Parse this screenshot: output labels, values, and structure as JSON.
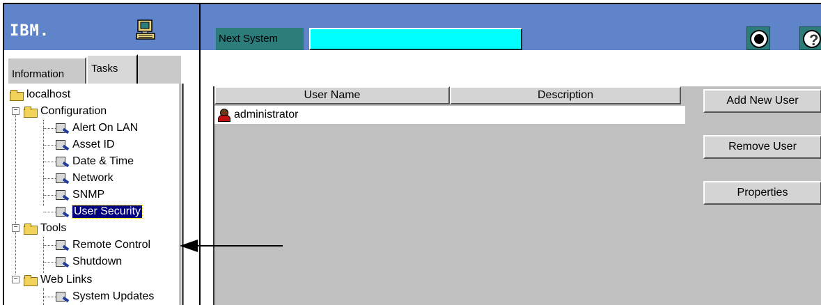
{
  "header": {
    "logo_text": "IBM.",
    "next_system_label": "Next System",
    "next_system_value": ""
  },
  "tabs": [
    {
      "label": "Information"
    },
    {
      "label": "Tasks"
    }
  ],
  "tree": {
    "root": "localhost",
    "groups": [
      {
        "label": "Configuration",
        "items": [
          "Alert On LAN",
          "Asset ID",
          "Date & Time",
          "Network",
          "SNMP",
          "User Security"
        ]
      },
      {
        "label": "Tools",
        "items": [
          "Remote Control",
          "Shutdown"
        ]
      },
      {
        "label": "Web Links",
        "items": [
          "System Updates"
        ]
      }
    ],
    "selected": "User Security"
  },
  "table": {
    "columns": [
      "User Name",
      "Description"
    ],
    "rows": [
      {
        "user": "administrator",
        "description": ""
      }
    ]
  },
  "buttons": {
    "add": "Add New User",
    "remove": "Remove User",
    "properties": "Properties"
  },
  "colors": {
    "header_blue": "#5f84c9",
    "teal": "#2c7c7c",
    "cyan_input": "#00ffff",
    "selection": "#00007f",
    "panel_gray": "#c0c0c0"
  },
  "icons": {
    "computer": "computer-icon",
    "go": "go-arrow-icon",
    "help": "help-icon",
    "folder": "folder-icon",
    "task": "task-icon",
    "user": "user-icon"
  }
}
